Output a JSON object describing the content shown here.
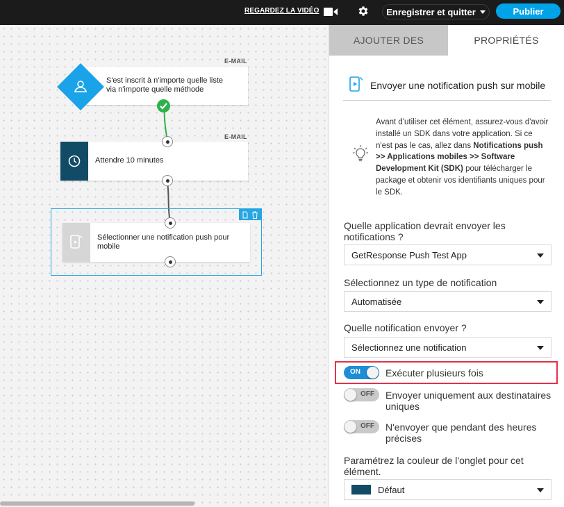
{
  "topbar": {
    "watch_video": "REGARDEZ LA VIDÉO",
    "save_quit": "Enregistrer et quitter",
    "publish": "Publier"
  },
  "workflow": {
    "node1": {
      "tag": "E-MAIL",
      "text_line1": "S'est inscrit à n'importe quelle liste",
      "text_line2": "via n'importe quelle méthode",
      "icon": "user-icon"
    },
    "node2": {
      "tag": "E-MAIL",
      "text": "Attendre 10 minutes",
      "icon": "clock-icon"
    },
    "node3": {
      "text_line1": "Sélectionner une notification push pour",
      "text_line2": "mobile",
      "icon": "mobile-push-icon"
    }
  },
  "panel": {
    "tabs": [
      {
        "label": "AJOUTER DES"
      },
      {
        "label": "PROPRIÉTÉS"
      }
    ],
    "title": "Envoyer une notification push sur mobile",
    "info": {
      "part1": "Avant d'utiliser cet élément, assurez-vous d'avoir installé un SDK dans votre application. Si ce n'est pas le cas, allez dans ",
      "bold1": "Notifications push >> Applications mobiles >> Software Development Kit (SDK)",
      "part2": " pour télécharger le package et obtenir vos identifiants uniques pour le SDK."
    },
    "app_label": "Quelle application devrait envoyer les notifications ?",
    "app_value": "GetResponse Push Test App",
    "type_label": "Sélectionnez un type de notification",
    "type_value": "Automatisée",
    "which_label": "Quelle notification envoyer ?",
    "which_value": "Sélectionnez une notification",
    "toggles": [
      {
        "state": "ON",
        "label": "Exécuter plusieurs fois"
      },
      {
        "state": "OFF",
        "label": "Envoyer uniquement aux destinataires uniques"
      },
      {
        "state": "OFF",
        "label": "N'envoyer que pendant des heures précises"
      }
    ],
    "color_label": "Paramétrez la couleur de l'onglet pour cet élément.",
    "color_value": "Défaut"
  },
  "colors": {
    "accent": "#00a2e8",
    "node_trigger": "#1aa3e8",
    "node_wait": "#124b66",
    "highlight": "#e53148",
    "success": "#2bb34a"
  }
}
